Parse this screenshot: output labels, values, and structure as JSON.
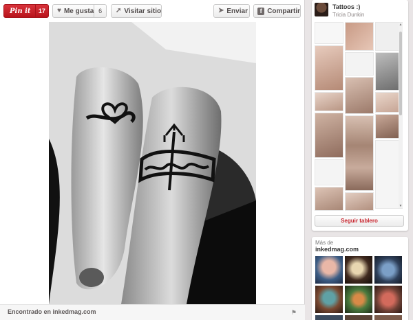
{
  "actions": {
    "pinit_label": "Pin it",
    "pinit_count": "17",
    "like_label": "Me gusta",
    "like_count": "6",
    "visit_label": "Visitar sitio",
    "send_label": "Enviar",
    "share_label": "Compartir"
  },
  "pin": {
    "source_text": "Encontrado en inkedmag.com"
  },
  "board": {
    "title": "Tattoos :)",
    "author": "Tricia Dunkin",
    "follow_label": "Seguir tablero"
  },
  "more": {
    "label": "Más de",
    "site": "inkedmag.com"
  },
  "icons": {
    "like": "heart-icon",
    "visit": "external-link-icon",
    "send": "send-icon",
    "share": "facebook-icon",
    "flag": "flag-icon"
  },
  "colors": {
    "pinit_red": "#c8232c",
    "background": "#e9e5e6"
  }
}
